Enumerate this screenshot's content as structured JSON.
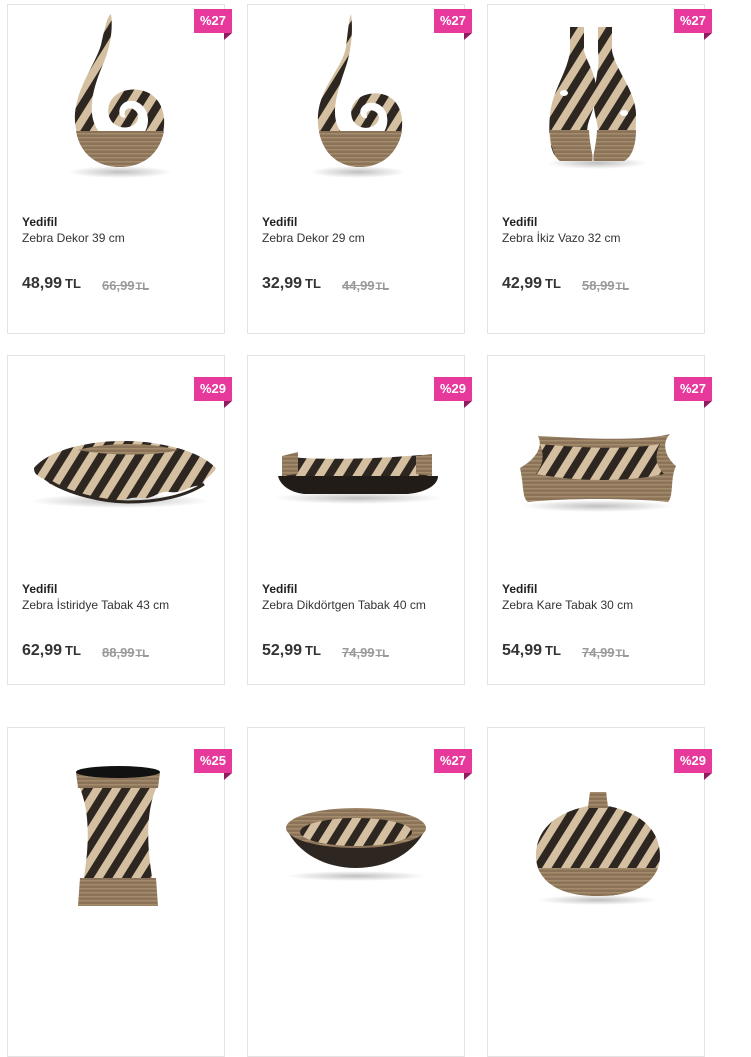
{
  "currency": "TL",
  "colors": {
    "badge": "#e6399b",
    "zebra_dark": "#2e2620",
    "zebra_light": "#d4c0a0",
    "wood": "#8a7358"
  },
  "products": [
    {
      "brand": "Yedifil",
      "name": "Zebra Dekor 39 cm",
      "discount": "%27",
      "price": "48,99",
      "old_price": "66,99",
      "icon": "zebra-spiral-decor-icon"
    },
    {
      "brand": "Yedifil",
      "name": "Zebra Dekor 29 cm",
      "discount": "%27",
      "price": "32,99",
      "old_price": "44,99",
      "icon": "zebra-spiral-decor-icon"
    },
    {
      "brand": "Yedifil",
      "name": "Zebra İkiz Vazo 32 cm",
      "discount": "%27",
      "price": "42,99",
      "old_price": "58,99",
      "icon": "zebra-twin-vase-icon"
    },
    {
      "brand": "Yedifil",
      "name": "Zebra İstiridye Tabak 43 cm",
      "discount": "%29",
      "price": "62,99",
      "old_price": "88,99",
      "icon": "zebra-oyster-plate-icon"
    },
    {
      "brand": "Yedifil",
      "name": "Zebra Dikdörtgen Tabak 40 cm",
      "discount": "%29",
      "price": "52,99",
      "old_price": "74,99",
      "icon": "zebra-rectangle-plate-icon"
    },
    {
      "brand": "Yedifil",
      "name": "Zebra Kare Tabak 30 cm",
      "discount": "%27",
      "price": "54,99",
      "old_price": "74,99",
      "icon": "zebra-square-plate-icon"
    },
    {
      "discount": "%25",
      "icon": "zebra-tall-vase-icon"
    },
    {
      "discount": "%27",
      "icon": "zebra-bowl-icon"
    },
    {
      "discount": "%29",
      "icon": "zebra-round-vase-icon"
    }
  ]
}
